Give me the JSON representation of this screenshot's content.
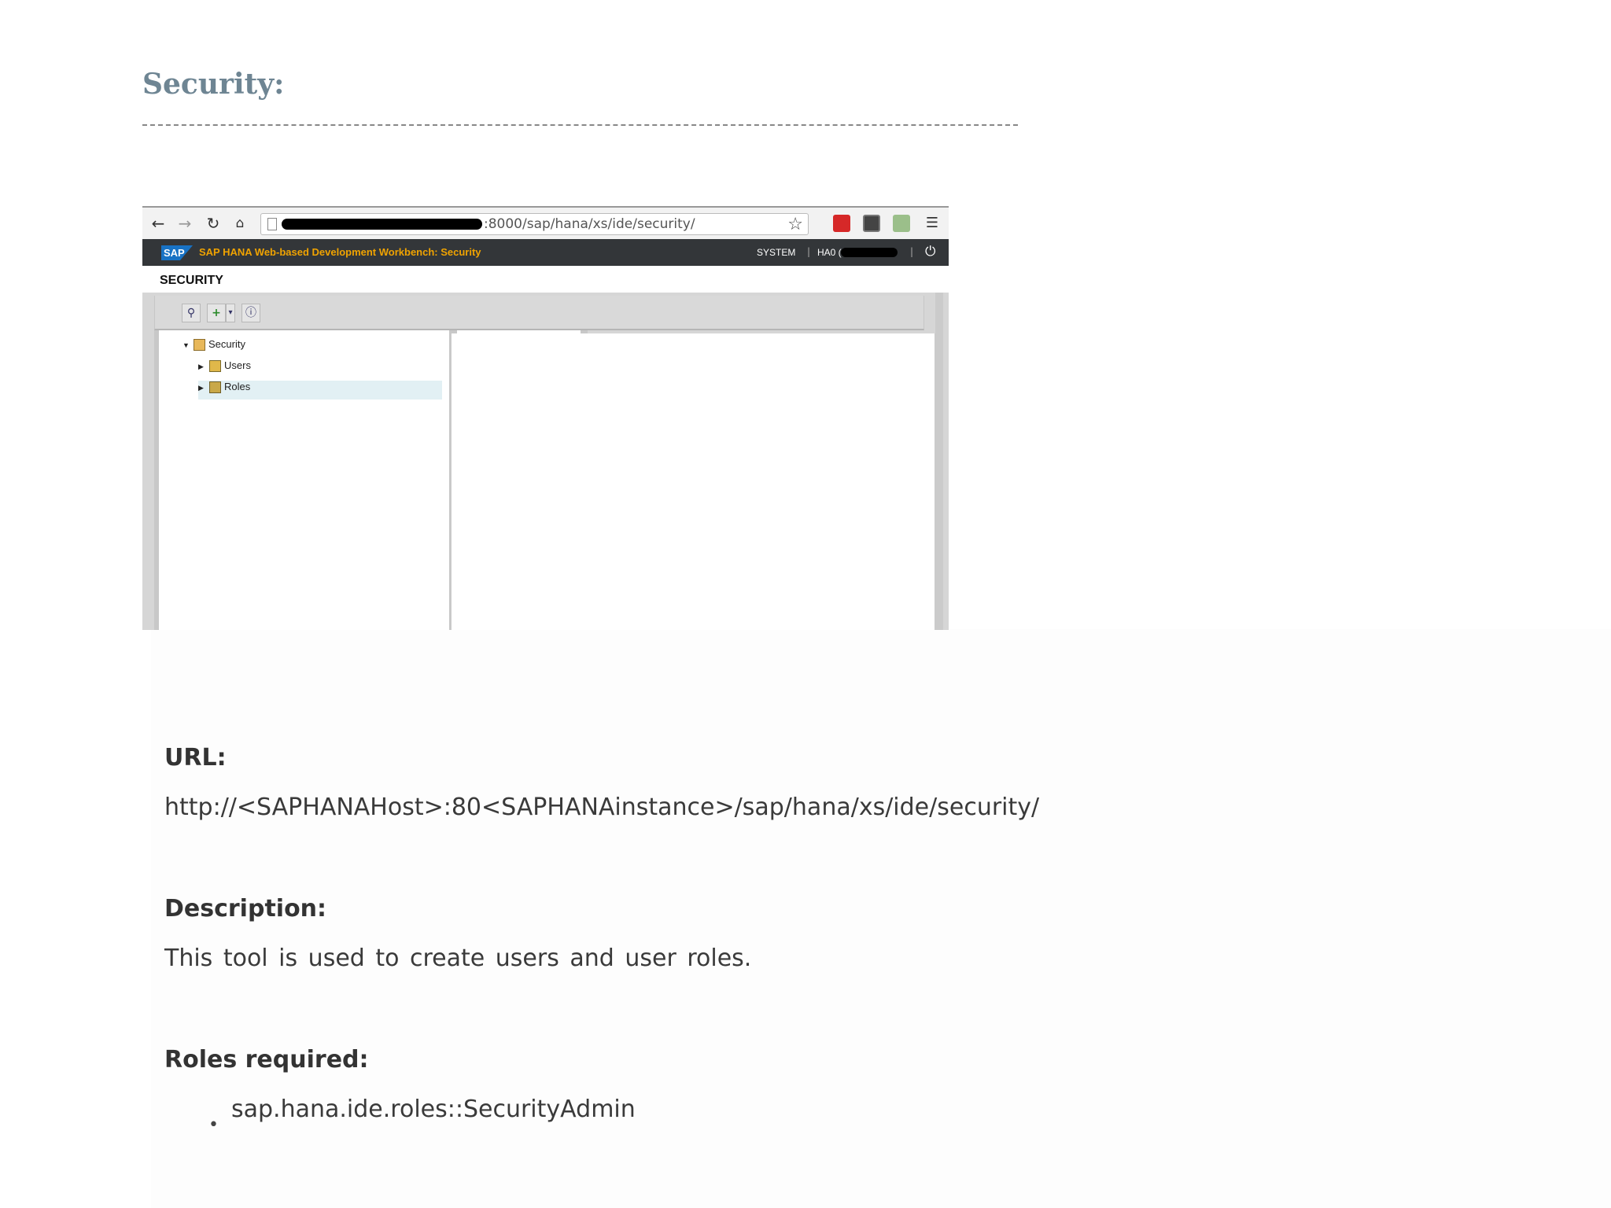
{
  "heading": "Security:",
  "screenshot": {
    "browser": {
      "url_visible": ":8000/sap/hana/xs/ide/security/"
    },
    "sap_header": {
      "logo": "SAP",
      "title": "SAP HANA Web-based Development Workbench: Security",
      "system_label": "SYSTEM",
      "separator": "|",
      "host_prefix": "HA0 ("
    },
    "section_title": "SECURITY",
    "tree": {
      "root": "Security",
      "children": [
        "Users",
        "Roles"
      ]
    },
    "colors": {
      "header_bg": "#333639",
      "title_accent": "#f0a300",
      "sap_blue": "#1872c4",
      "selected_row": "#e2f0f4"
    }
  },
  "sections": {
    "url_label": "URL:",
    "url_value": "http://<SAPHANAHost>:80<SAPHANAinstance>/sap/hana/xs/ide/security/",
    "description_label": "Description:",
    "description_value": "This tool is used to create users and user roles.",
    "roles_label": "Roles required:",
    "roles": [
      "sap.hana.ide.roles::SecurityAdmin"
    ]
  }
}
